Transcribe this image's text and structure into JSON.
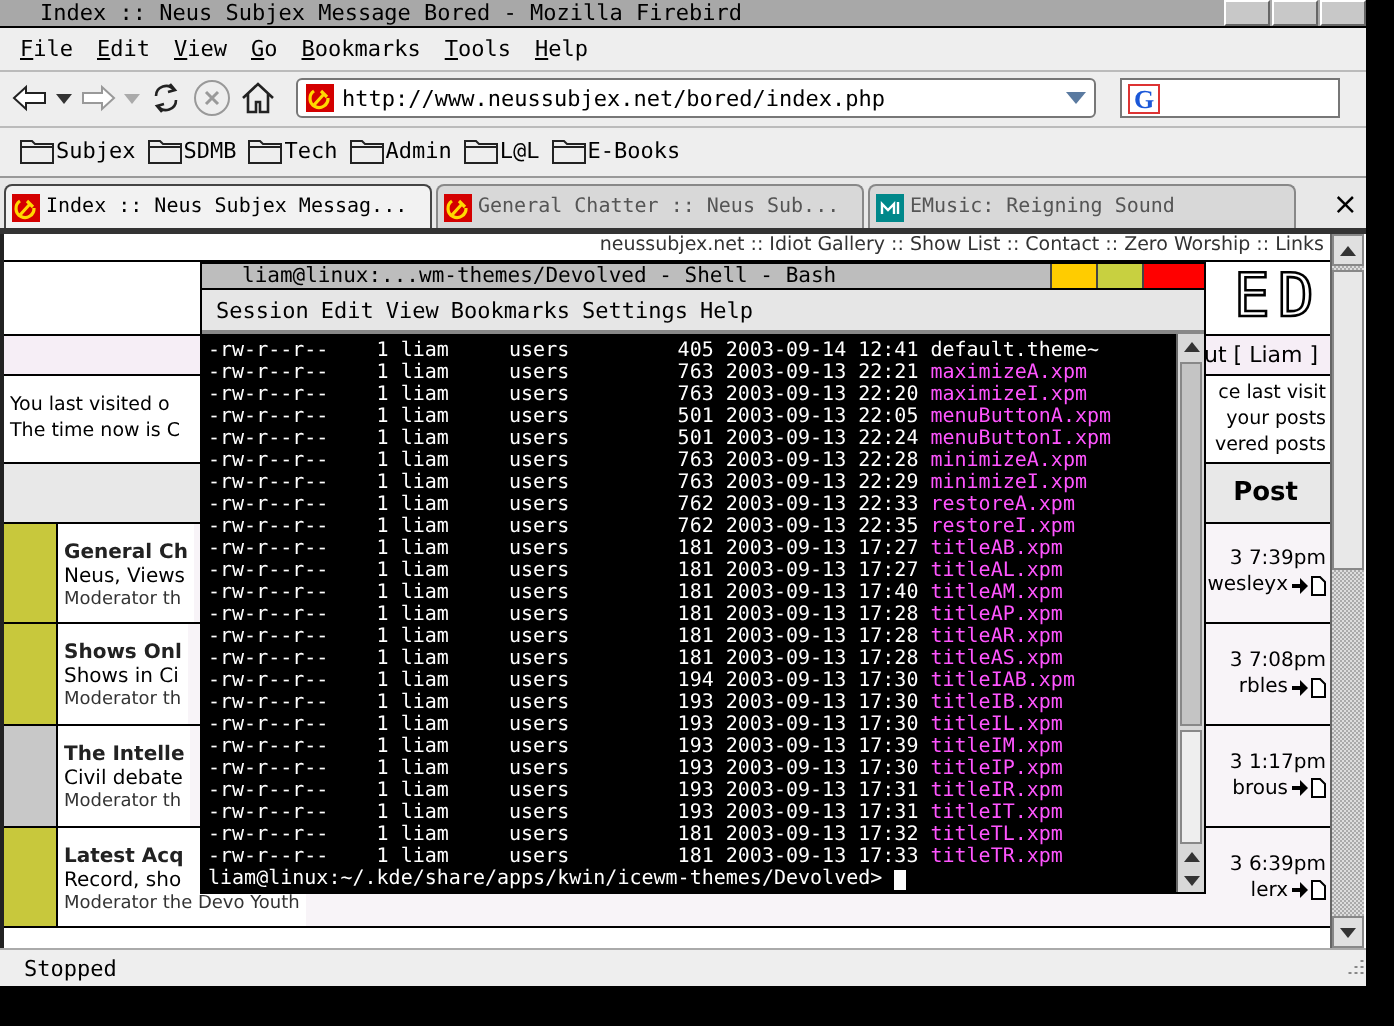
{
  "window": {
    "title": "Index :: Neus Subjex Message Bored - Mozilla Firebird"
  },
  "menu": [
    "File",
    "Edit",
    "View",
    "Go",
    "Bookmarks",
    "Tools",
    "Help"
  ],
  "address": {
    "value": "http://www.neussubjex.net/bored/index.php"
  },
  "search": {
    "engine_label": "G"
  },
  "bookmarks": [
    "Subjex",
    "SDMB",
    "Tech",
    "Admin",
    "L@L",
    "E-Books"
  ],
  "tabs": [
    {
      "label": "Index :: Neus Subjex Messag...",
      "selected": true,
      "kind": "site"
    },
    {
      "label": "General Chatter :: Neus Sub...",
      "selected": false,
      "kind": "site"
    },
    {
      "label": "EMusic: Reigning Sound",
      "selected": false,
      "kind": "music"
    }
  ],
  "tab_close": "×",
  "page": {
    "nav": "neussubjex.net :: Idiot Gallery :: Show List :: Contact :: Zero Worship :: Links",
    "logo": "ED",
    "user": "ut [ Liam ]",
    "visit_left": [
      "You last visited o",
      "The time now is C"
    ],
    "visit_right": [
      "ce last visit",
      "your posts",
      "vered posts"
    ],
    "last_post_header": "Post",
    "forums": [
      {
        "title": "General Ch",
        "description": "Neus, Views",
        "moderator": "Moderator th",
        "last_time": "3 7:39pm",
        "last_user": "wesleyx",
        "color": "#c8c83c"
      },
      {
        "title": "Shows Onl",
        "description": "Shows in Ci",
        "moderator": "Moderator th",
        "last_time": "3 7:08pm",
        "last_user": "rbles",
        "color": "#c8c83c"
      },
      {
        "title": "The Intelle",
        "description": "Civil debate",
        "moderator": "Moderator th",
        "last_time": "3 1:17pm",
        "last_user": "brous",
        "color": "#c8c8c8"
      },
      {
        "title": "Latest Acq",
        "description": "Record, sho",
        "moderator": "Moderator the Devo Youth",
        "last_time": "3 6:39pm",
        "last_user": "lerx",
        "color": "#c8c83c"
      }
    ]
  },
  "terminal": {
    "title": "liam@linux:...wm-themes/Devolved - Shell - Bash",
    "menu": [
      "Session",
      "Edit",
      "View",
      "Bookmarks",
      "Settings",
      "Help"
    ],
    "lines": [
      {
        "info": "-rw-r--r--    1 liam     users         405 2003-09-14 12:41",
        "name": "default.theme~",
        "color": "#ffffff"
      },
      {
        "info": "-rw-r--r--    1 liam     users         763 2003-09-13 22:21",
        "name": "maximizeA.xpm",
        "color": "#ff55ff"
      },
      {
        "info": "-rw-r--r--    1 liam     users         763 2003-09-13 22:20",
        "name": "maximizeI.xpm",
        "color": "#ff55ff"
      },
      {
        "info": "-rw-r--r--    1 liam     users         501 2003-09-13 22:05",
        "name": "menuButtonA.xpm",
        "color": "#ff55ff"
      },
      {
        "info": "-rw-r--r--    1 liam     users         501 2003-09-13 22:24",
        "name": "menuButtonI.xpm",
        "color": "#ff55ff"
      },
      {
        "info": "-rw-r--r--    1 liam     users         763 2003-09-13 22:28",
        "name": "minimizeA.xpm",
        "color": "#ff55ff"
      },
      {
        "info": "-rw-r--r--    1 liam     users         763 2003-09-13 22:29",
        "name": "minimizeI.xpm",
        "color": "#ff55ff"
      },
      {
        "info": "-rw-r--r--    1 liam     users         762 2003-09-13 22:33",
        "name": "restoreA.xpm",
        "color": "#ff55ff"
      },
      {
        "info": "-rw-r--r--    1 liam     users         762 2003-09-13 22:35",
        "name": "restoreI.xpm",
        "color": "#ff55ff"
      },
      {
        "info": "-rw-r--r--    1 liam     users         181 2003-09-13 17:27",
        "name": "titleAB.xpm",
        "color": "#ff55ff"
      },
      {
        "info": "-rw-r--r--    1 liam     users         181 2003-09-13 17:27",
        "name": "titleAL.xpm",
        "color": "#ff55ff"
      },
      {
        "info": "-rw-r--r--    1 liam     users         181 2003-09-13 17:40",
        "name": "titleAM.xpm",
        "color": "#ff55ff"
      },
      {
        "info": "-rw-r--r--    1 liam     users         181 2003-09-13 17:28",
        "name": "titleAP.xpm",
        "color": "#ff55ff"
      },
      {
        "info": "-rw-r--r--    1 liam     users         181 2003-09-13 17:28",
        "name": "titleAR.xpm",
        "color": "#ff55ff"
      },
      {
        "info": "-rw-r--r--    1 liam     users         181 2003-09-13 17:28",
        "name": "titleAS.xpm",
        "color": "#ff55ff"
      },
      {
        "info": "-rw-r--r--    1 liam     users         194 2003-09-13 17:30",
        "name": "titleIAB.xpm",
        "color": "#ff55ff"
      },
      {
        "info": "-rw-r--r--    1 liam     users         193 2003-09-13 17:30",
        "name": "titleIB.xpm",
        "color": "#ff55ff"
      },
      {
        "info": "-rw-r--r--    1 liam     users         193 2003-09-13 17:30",
        "name": "titleIL.xpm",
        "color": "#ff55ff"
      },
      {
        "info": "-rw-r--r--    1 liam     users         193 2003-09-13 17:39",
        "name": "titleIM.xpm",
        "color": "#ff55ff"
      },
      {
        "info": "-rw-r--r--    1 liam     users         193 2003-09-13 17:30",
        "name": "titleIP.xpm",
        "color": "#ff55ff"
      },
      {
        "info": "-rw-r--r--    1 liam     users         193 2003-09-13 17:31",
        "name": "titleIR.xpm",
        "color": "#ff55ff"
      },
      {
        "info": "-rw-r--r--    1 liam     users         193 2003-09-13 17:31",
        "name": "titleIT.xpm",
        "color": "#ff55ff"
      },
      {
        "info": "-rw-r--r--    1 liam     users         181 2003-09-13 17:32",
        "name": "titleTL.xpm",
        "color": "#ff55ff"
      },
      {
        "info": "-rw-r--r--    1 liam     users         181 2003-09-13 17:33",
        "name": "titleTR.xpm",
        "color": "#ff55ff"
      }
    ],
    "prompt": "liam@linux:~/.kde/share/apps/kwin/icewm-themes/Devolved>"
  },
  "status_bar": {
    "text": "Stopped"
  }
}
